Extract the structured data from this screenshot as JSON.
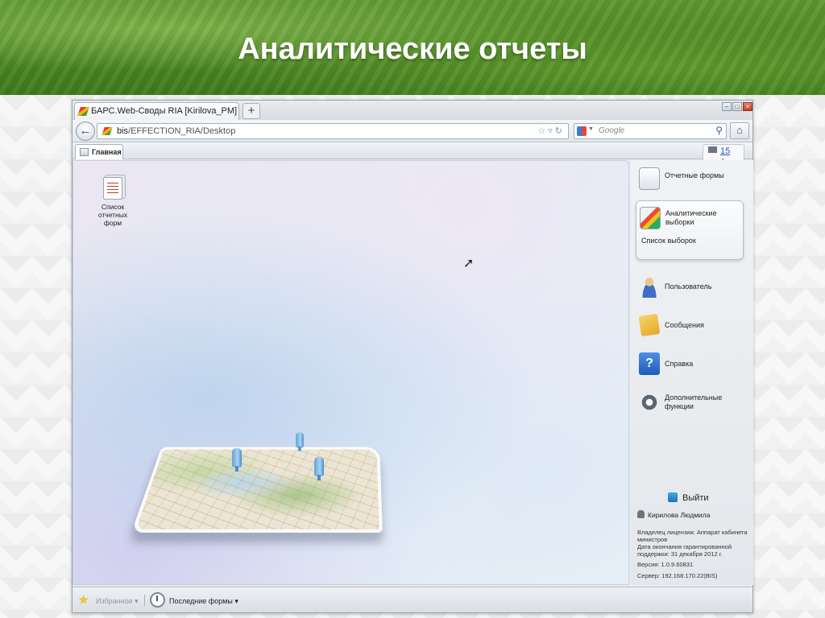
{
  "slide": {
    "title": "Аналитические отчеты"
  },
  "browser": {
    "tab_title": "БАРС.Web-Своды RIA [Kirilova_PM]",
    "new_tab_label": "+",
    "url_host": "bis",
    "url_path": "/EFFECTION_RIA/Desktop",
    "search_placeholder": "Google"
  },
  "app": {
    "tab_label": "Главная",
    "counter_value": "15",
    "desktop_icon_label": "Список отчетных форм",
    "sidebar": {
      "items": [
        {
          "label": "Отчетные формы",
          "icon": "report-forms-icon"
        },
        {
          "label": "Аналитические выборки",
          "icon": "analytic-selections-icon",
          "sub_label": "Список выборок"
        },
        {
          "label": "Пользователь",
          "icon": "user-icon"
        },
        {
          "label": "Сообщения",
          "icon": "messages-icon"
        },
        {
          "label": "Справка",
          "icon": "help-icon"
        },
        {
          "label": "Дополнительные функции",
          "icon": "gear-icon"
        }
      ],
      "logout_label": "Выйти",
      "user_name": "Кирилова Людмила",
      "license_owner": "Владелец лицензии: Аппарат кабинета министров",
      "warranty_end": "Дата окончания гарантированной поддержки: 31 декабря 2012 г.",
      "version": "Версия: 1.0.9.60831",
      "server": "Сервер: 192.168.170.22(BIS)"
    },
    "bottombar": {
      "favorites_label": "Избранное ▾",
      "recent_forms_label": "Последние формы ▾"
    }
  }
}
